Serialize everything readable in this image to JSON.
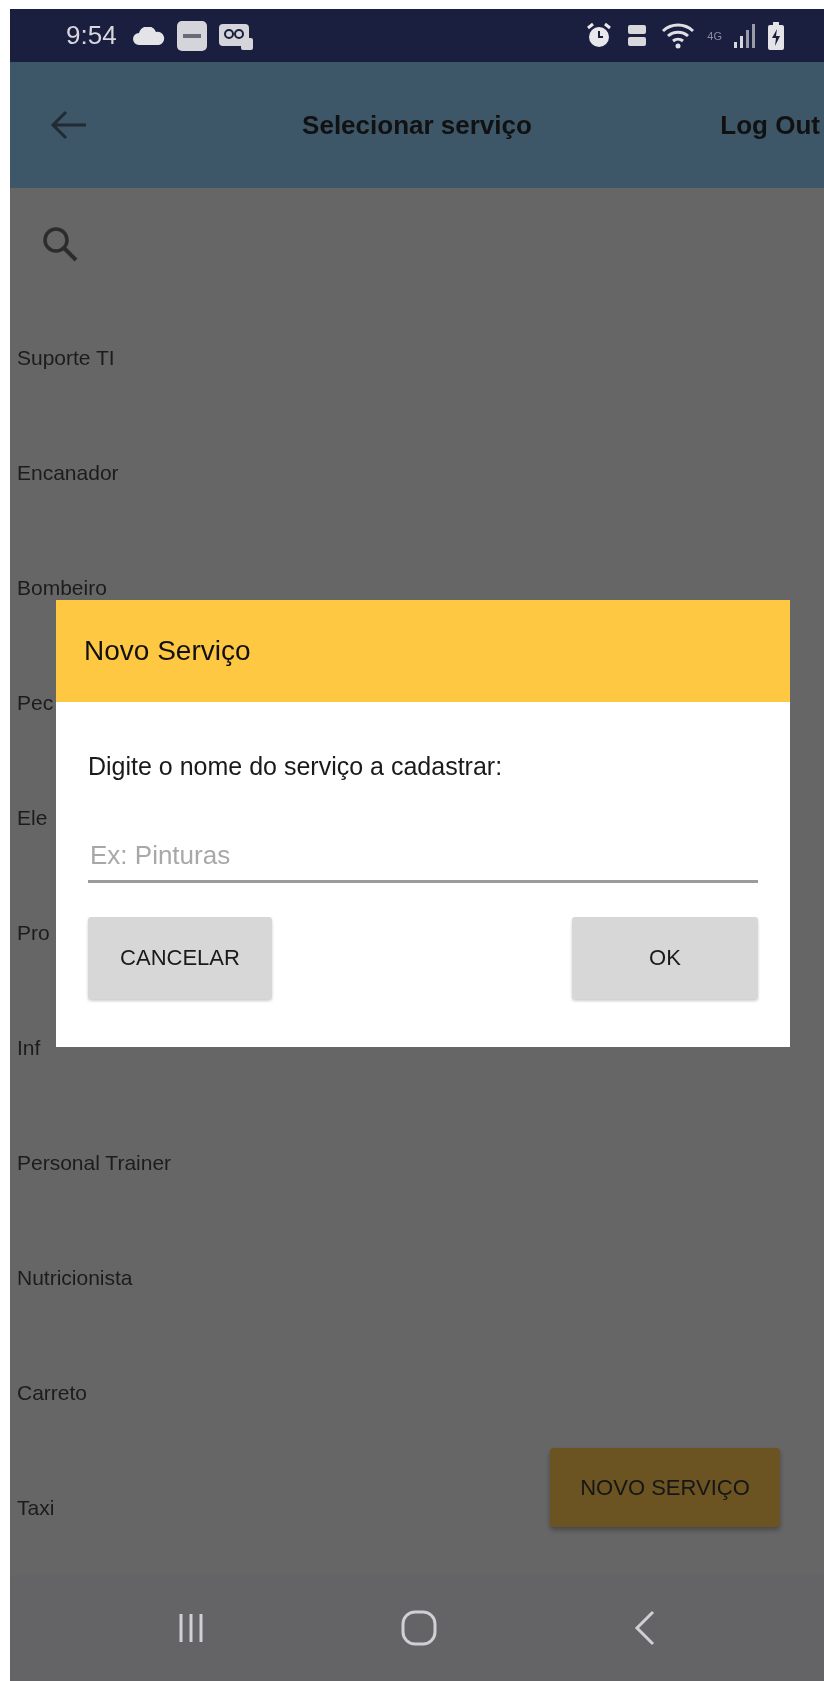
{
  "status_bar": {
    "time": "9:54",
    "network": "4G"
  },
  "app_bar": {
    "title": "Selecionar serviço",
    "action": "Log Out"
  },
  "services": [
    "Suporte TI",
    "Encanador",
    "Bombeiro",
    "Pec",
    "Ele",
    "Pro",
    "Inf",
    "Personal Trainer",
    "Nutricionista",
    "Carreto",
    "Taxi"
  ],
  "fab": {
    "label": "NOVO SERVIÇO"
  },
  "dialog": {
    "title": "Novo Serviço",
    "message": "Digite o nome do serviço a cadastrar:",
    "input": {
      "placeholder": "Ex: Pinturas"
    },
    "buttons": [
      {
        "label": "CANCELAR",
        "kind": "cancel"
      },
      {
        "label": "OK",
        "kind": "confirm"
      }
    ]
  }
}
